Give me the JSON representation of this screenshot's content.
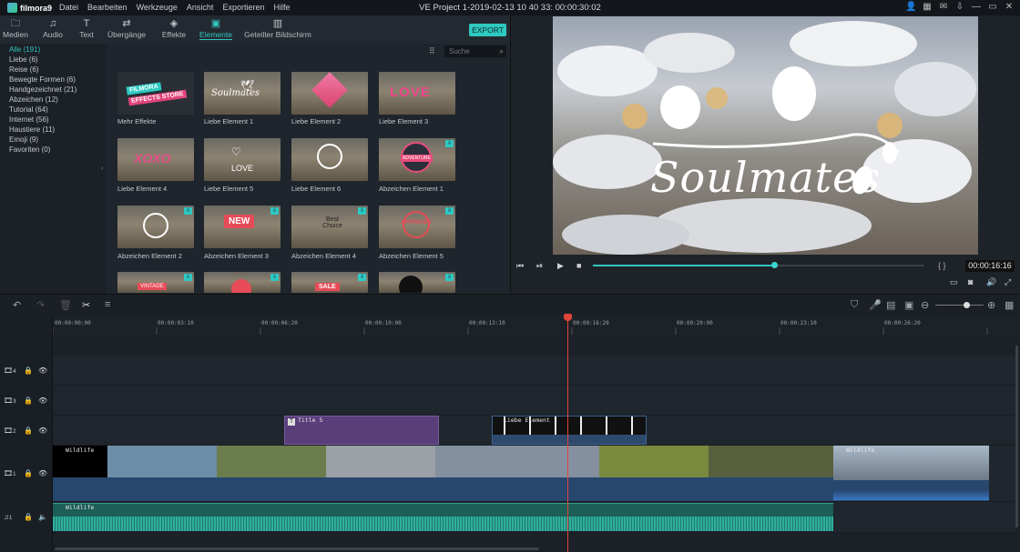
{
  "app": {
    "logo": "filmora9",
    "title": "VE Project 1-2019-02-13 10 40 33: 00:00:30:02"
  },
  "menu": [
    "Datei",
    "Bearbeiten",
    "Werkzeuge",
    "Ansicht",
    "Exportieren",
    "Hilfe"
  ],
  "window_controls": {
    "user": "user-icon",
    "grid": "grid-icon",
    "mail": "mail-icon",
    "download": "download-icon",
    "minimize": "minimize-icon",
    "restore": "restore-icon",
    "close": "close-icon"
  },
  "toolbar": [
    {
      "label": "Medien",
      "icon": "folder-icon"
    },
    {
      "label": "Audio",
      "icon": "music-note-icon"
    },
    {
      "label": "Text",
      "icon": "text-icon"
    },
    {
      "label": "Übergänge",
      "icon": "transition-icon"
    },
    {
      "label": "Effekte",
      "icon": "effects-icon"
    },
    {
      "label": "Elemente",
      "icon": "image-icon",
      "active": true
    },
    {
      "label": "Geteilter Bildschirm",
      "icon": "split-screen-icon"
    }
  ],
  "export_label": "EXPORT",
  "categories": [
    {
      "label": "Alle (191)",
      "selected": true
    },
    {
      "label": "Liebe (6)"
    },
    {
      "label": "Reise (6)"
    },
    {
      "label": "Bewegte Formen (6)"
    },
    {
      "label": "Handgezeichnet (21)"
    },
    {
      "label": "Abzeichen (12)"
    },
    {
      "label": "Tutorial (64)"
    },
    {
      "label": "Internet (56)"
    },
    {
      "label": "Haustiere (11)"
    },
    {
      "label": "Emoji (9)"
    },
    {
      "label": "Favoriten (0)"
    }
  ],
  "search": {
    "placeholder": "Suche"
  },
  "elements": [
    {
      "label": "Mehr Effekte",
      "thumb_text": "FILMORA EFFECTS STORE"
    },
    {
      "label": "Liebe Element 1",
      "thumb_text": "Soulmates"
    },
    {
      "label": "Liebe Element 2",
      "thumb_text": ""
    },
    {
      "label": "Liebe Element 3",
      "thumb_text": "LOVE"
    },
    {
      "label": "Liebe Element 4",
      "thumb_text": "XOXO"
    },
    {
      "label": "Liebe Element 5",
      "thumb_text": "LOVE"
    },
    {
      "label": "Liebe Element 6",
      "thumb_text": ""
    },
    {
      "label": "Abzeichen Element 1",
      "thumb_text": "ADVENTURE"
    },
    {
      "label": "Abzeichen Element 2",
      "thumb_text": ""
    },
    {
      "label": "Abzeichen Element 3",
      "thumb_text": "NEW"
    },
    {
      "label": "Abzeichen Element 4",
      "thumb_text": "Best Choice"
    },
    {
      "label": "Abzeichen Element 5",
      "thumb_text": "APPROVED"
    },
    {
      "label": "",
      "thumb_text": "VINTAGE"
    },
    {
      "label": "",
      "thumb_text": ""
    },
    {
      "label": "",
      "thumb_text": "SALE"
    },
    {
      "label": "",
      "thumb_text": ""
    }
  ],
  "preview": {
    "overlay_text": "Soulmates",
    "timecode": "00:00:16:16",
    "progress": 0.55,
    "brackets": "{   }"
  },
  "timeline": {
    "ruler": [
      "00:00:00:00",
      "00:00:03:10",
      "00:00:06:20",
      "00:00:10:00",
      "00:00:13:10",
      "00:00:16:20",
      "00:00:20:00",
      "00:00:23:10",
      "00:00:26:20"
    ],
    "tracks": [
      {
        "name": "4",
        "type": "video"
      },
      {
        "name": "3",
        "type": "video"
      },
      {
        "name": "2",
        "type": "video"
      },
      {
        "name": "1",
        "type": "video"
      },
      {
        "name": "1",
        "type": "audio"
      }
    ],
    "clips": {
      "title": "Title 5",
      "element": "Liebe Element 1",
      "video1": "Wildlife",
      "video2": "Wildlife",
      "audio": "Wildlife"
    }
  }
}
